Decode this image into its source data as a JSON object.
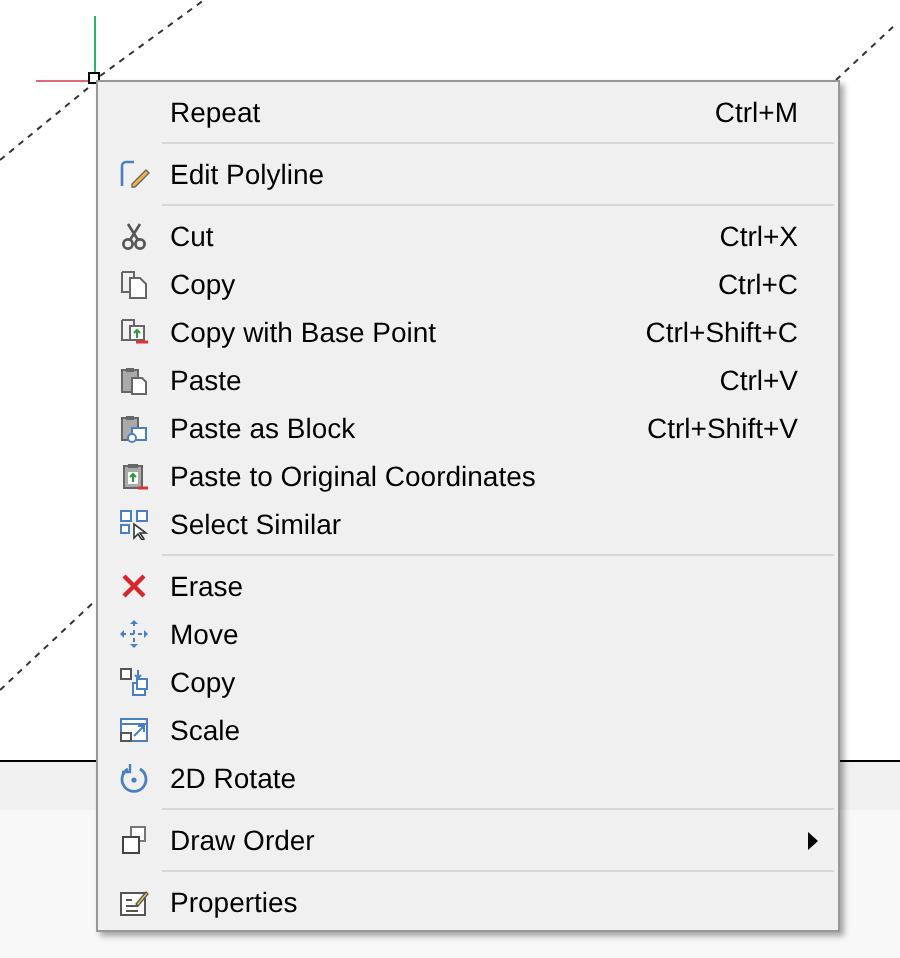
{
  "context_menu": {
    "groups": [
      [
        {
          "label": "Repeat",
          "shortcut": "Ctrl+M"
        }
      ],
      [
        {
          "label": "Edit Polyline"
        }
      ],
      [
        {
          "label": "Cut",
          "shortcut": "Ctrl+X"
        },
        {
          "label": "Copy",
          "shortcut": "Ctrl+C"
        },
        {
          "label": "Copy with Base Point",
          "shortcut": "Ctrl+Shift+C"
        },
        {
          "label": "Paste",
          "shortcut": "Ctrl+V"
        },
        {
          "label": "Paste as Block",
          "shortcut": "Ctrl+Shift+V"
        },
        {
          "label": "Paste to Original Coordinates"
        },
        {
          "label": "Select Similar"
        }
      ],
      [
        {
          "label": "Erase"
        },
        {
          "label": "Move"
        },
        {
          "label": "Copy"
        },
        {
          "label": "Scale"
        },
        {
          "label": "2D Rotate"
        }
      ],
      [
        {
          "label": "Draw Order",
          "submenu": true
        }
      ],
      [
        {
          "label": "Properties"
        }
      ]
    ]
  }
}
